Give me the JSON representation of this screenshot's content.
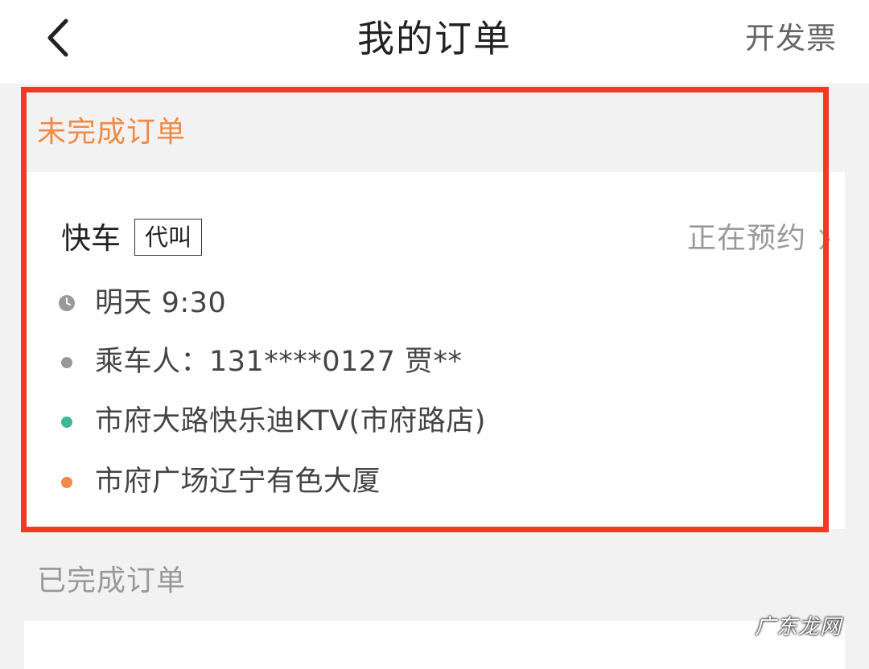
{
  "header": {
    "title": "我的订单",
    "invoice_label": "开发票",
    "back_icon": "chevron-left-icon"
  },
  "pending_section": {
    "title": "未完成订单",
    "title_color": "#f08a47",
    "order": {
      "car_type": "快车",
      "badge": "代叫",
      "status": "正在预约",
      "time": "明天 9:30",
      "passenger": "乘车人：131****0127 贾**",
      "origin": "市府大路快乐迪KTV(市府路店)",
      "destination": "市府广场辽宁有色大厦",
      "origin_dot_color": "#3ab89a",
      "destination_dot_color": "#f08a47"
    },
    "highlight_color": "#f03a22"
  },
  "completed_section": {
    "title": "已完成订单"
  },
  "watermark": "广东龙网"
}
